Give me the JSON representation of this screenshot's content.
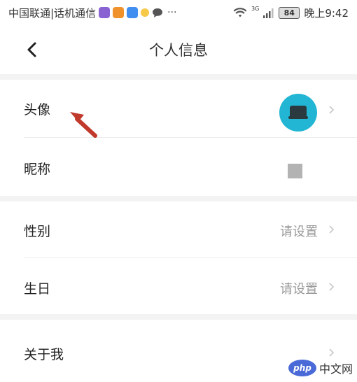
{
  "status_bar": {
    "carrier": "中国联通|话机通信",
    "more": "···",
    "network": "3G",
    "battery": "84",
    "time": "晚上9:42",
    "icons": [
      "app-icon-purple",
      "app-icon-orange",
      "app-icon-blue",
      "app-icon-yellow",
      "message-icon",
      "wifi-icon",
      "signal-icon",
      "battery-icon"
    ]
  },
  "header": {
    "title": "个人信息",
    "back_icon": "back-arrow-icon"
  },
  "rows": [
    {
      "label": "头像",
      "value": "",
      "icon": "avatar"
    },
    {
      "label": "昵称",
      "value": "",
      "icon": "nickname-placeholder"
    },
    {
      "label": "性别",
      "value": "请设置"
    },
    {
      "label": "生日",
      "value": "请设置"
    },
    {
      "label": "关于我",
      "value": ""
    }
  ],
  "watermark": {
    "logo": "php",
    "text": "中文网"
  },
  "colors": {
    "avatar_bg": "#22b6d4",
    "annotation_arrow": "#c0392b",
    "value_text": "#9a9a9a",
    "section_gap": "#f3f3f3"
  }
}
